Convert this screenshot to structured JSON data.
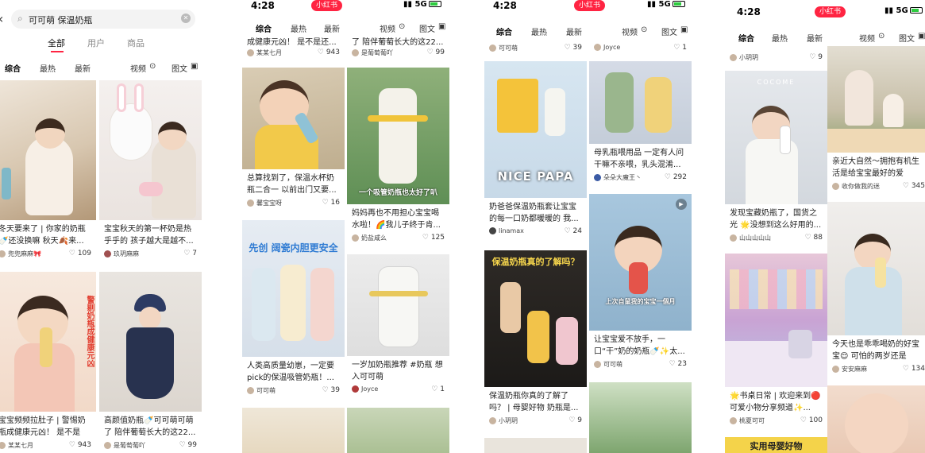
{
  "status": {
    "time": "4:28",
    "network": "5G",
    "badge": "小红书"
  },
  "search": {
    "query": "可可萌 保温奶瓶"
  },
  "top_tabs": [
    "全部",
    "用户",
    "商品"
  ],
  "filters": {
    "comprehensive": "综合",
    "hot": "最热",
    "latest": "最新",
    "video": "视频",
    "image_text": "图文"
  },
  "panel1": {
    "cards": [
      {
        "title": "冬天要来了 | 你家的奶瓶🍼还没换嘛 秋天🍂来...",
        "author": "兜兜麻麻🎀",
        "likes": "109"
      },
      {
        "title": "宝宝秋天的第一杯奶是热乎乎的 孩子越大是越不...",
        "author": "玖玥麻麻",
        "likes": "7"
      },
      {
        "title": "宝宝频频拉肚子 | 警惕奶瓶成健康元凶！ 是不是还...",
        "author": "某某七月",
        "likes": "943"
      },
      {
        "title": "高颜值奶瓶🍼可可萌可萌了 陪伴葡萄长大的这22...",
        "author": "是葡萄葡吖",
        "likes": "99"
      }
    ],
    "overlay": "警剔奶瓶成健康元凶"
  },
  "panel2": {
    "top": [
      {
        "title": "成健康元凶！ 是不是还...",
        "author": "某某七月",
        "likes": "943"
      },
      {
        "title": "了 陪伴葡萄长大的这22...",
        "author": "是葡萄葡吖",
        "likes": "99"
      }
    ],
    "cards": [
      {
        "title": "总算找到了，保温水杯奶瓶二合一 以前出门又要...",
        "author": "馨宝宝呀",
        "likes": "16"
      },
      {
        "title": "妈妈再也不用担心宝宝喝水啦！🌈我儿子终于肯...",
        "author": "奶盐咸么",
        "likes": "125",
        "overlay": "一个吸管奶瓶也太好了叭"
      },
      {
        "title": "人类高质量幼崽，一定要pick的保温吸管奶瓶！...",
        "author": "可可萌",
        "likes": "39",
        "overlay": "先创 阔瓷内胆更安全"
      },
      {
        "title": "一岁加奶瓶推荐 #奶瓶 想入可可萌",
        "author": "Joyce",
        "likes": "1"
      }
    ]
  },
  "panel3": {
    "top": [
      {
        "author": "可可萌",
        "likes": "39"
      },
      {
        "author": "Joyce",
        "likes": "1"
      }
    ],
    "cards": [
      {
        "title": "奶爸爸保温奶瓶套让宝宝的每一口奶都暖暖的 我...",
        "author": "linamax",
        "likes": "24",
        "overlay": "NICE PAPA"
      },
      {
        "title": "母乳瓶喂用品 一定有人问干嘛不亲喂，乳头混淆...",
        "author": "朵朵大魔王丶",
        "likes": "292"
      },
      {
        "title": "保温奶瓶你真的了解了吗？ | 母婴好物 奶瓶是...",
        "author": "小玥玥",
        "likes": "9",
        "overlay": "保温奶瓶真的了解吗？"
      },
      {
        "title": "让宝宝爱不放手，一口“干”奶的奶瓶🍼✨太...",
        "author": "可可萌",
        "likes": "23",
        "overlay": "上次自鼠我的宝宝一個月"
      }
    ]
  },
  "panel4": {
    "top": [
      {
        "author": "小玥玥",
        "likes": "9"
      }
    ],
    "cards": [
      {
        "title": "亲近大自然～拥抱有机生活是给宝宝最好的爱 🟡...",
        "author": "收你做我的迷",
        "likes": "345"
      },
      {
        "title": "发现宝藏奶瓶了，国货之光 🌟没想到这么好用的...",
        "author": "山山山山山",
        "likes": "88"
      },
      {
        "title": "今天也是乖乖喝奶的好宝宝😌 可怕的两岁还是到...",
        "author": "安安麻麻",
        "likes": "134"
      },
      {
        "title": "🌟书桌日常 | 欢迎来到🔴可爱小物分享频道✨...",
        "author": "桃夏可可",
        "likes": "100"
      }
    ],
    "bottom_overlay": "实用母婴好物"
  },
  "colors": {
    "brand_red": "#ff2442",
    "text": "#222222",
    "bg": "#ffffff"
  }
}
